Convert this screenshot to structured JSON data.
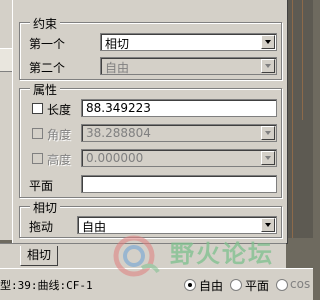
{
  "constraint": {
    "title": "约束",
    "first_label": "第一个",
    "first_value": "相切",
    "second_label": "第二个",
    "second_value": "自由"
  },
  "properties": {
    "title": "属性",
    "length_label": "长度",
    "length_value": "88.349223",
    "angle_label": "角度",
    "angle_value": "38.288804",
    "height_label": "高度",
    "height_value": "0.000000",
    "plane_label": "平面",
    "plane_value": ""
  },
  "tangent": {
    "title": "相切",
    "drag_label": "拖动",
    "drag_value": "自由"
  },
  "bottom_tabs": {
    "tab_active": "相切"
  },
  "status": {
    "text": "型:39:曲线:CF-1",
    "radio_free": "自由",
    "radio_plane": "平面",
    "radio_third": "cos"
  },
  "watermark": {
    "text": "野火论坛"
  },
  "colors": {
    "dialog_bg": "#d4d0c8",
    "disabled_text": "#808080",
    "watermark": "#7ec08e"
  }
}
